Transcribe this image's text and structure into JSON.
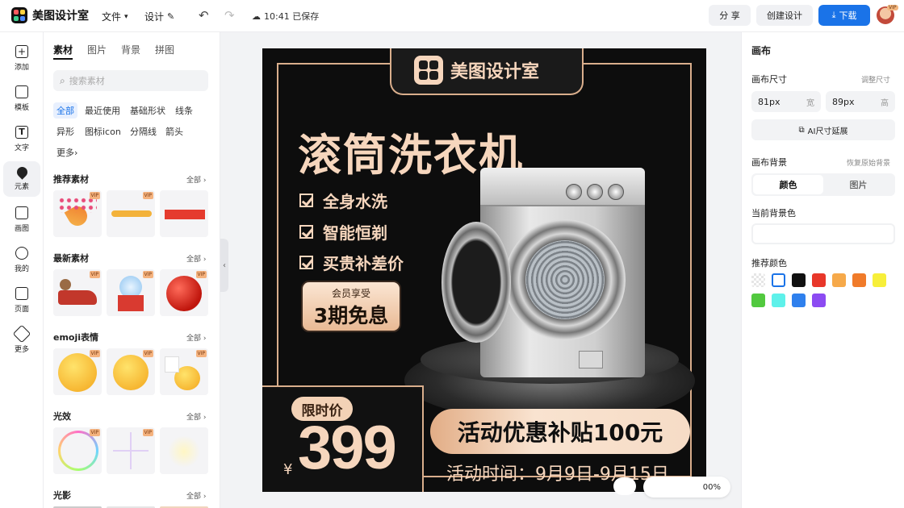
{
  "app": {
    "name": "美图设计室",
    "menu_file": "文件",
    "menu_design": "设计",
    "saved_status": "10:41 已保存",
    "btn_share": "分 享",
    "btn_create": "创建设计",
    "btn_download": "下载",
    "avatar_badge": "VIP"
  },
  "rail": [
    {
      "label": "添加",
      "icon": "plus-icon"
    },
    {
      "label": "模板",
      "icon": "template-icon"
    },
    {
      "label": "文字",
      "icon": "text-icon"
    },
    {
      "label": "元素",
      "icon": "element-icon",
      "active": true
    },
    {
      "label": "画图",
      "icon": "draw-icon"
    },
    {
      "label": "我的",
      "icon": "user-icon"
    },
    {
      "label": "页面",
      "icon": "page-icon"
    },
    {
      "label": "更多",
      "icon": "cube-icon"
    }
  ],
  "assets": {
    "tabs": [
      "素材",
      "图片",
      "背景",
      "拼图"
    ],
    "search_placeholder": "搜索素材",
    "chips": [
      "全部",
      "最近使用",
      "基础形状",
      "线条",
      "异形",
      "图标icon",
      "分隔线",
      "箭头",
      "更多"
    ],
    "sections": [
      {
        "title": "推荐素材",
        "all": "全部"
      },
      {
        "title": "最新素材",
        "all": "全部"
      },
      {
        "title": "emoji表情",
        "all": "全部"
      },
      {
        "title": "光效",
        "all": "全部"
      },
      {
        "title": "光影",
        "all": "全部"
      }
    ],
    "vip_label": "VIP"
  },
  "poster": {
    "brand": "美图设计室",
    "headline": "滚筒洗衣机",
    "features": [
      "全身水洗",
      "智能恒剃",
      "买贵补差价"
    ],
    "badge_top": "会员享受",
    "badge_main": "3期免息",
    "price_tag": "限时价",
    "currency": "¥",
    "price": "399",
    "promo": "活动优惠补贴100元",
    "date": "活动时间：9月9日-9月15日"
  },
  "zoom": "00%",
  "props": {
    "title": "画布",
    "size_label": "画布尺寸",
    "resize_link": "调整尺寸",
    "width_value": "81px",
    "width_unit": "宽",
    "height_value": "89px",
    "height_unit": "高",
    "ai_extend": "AI尺寸延展",
    "bg_label": "画布背景",
    "restore_link": "恢复原始背景",
    "seg_color": "颜色",
    "seg_image": "图片",
    "current_bg_label": "当前背景色",
    "recommended_label": "推荐颜色",
    "swatches": [
      "transparent",
      "#ffffff",
      "#111111",
      "#e8372a",
      "#f6a94a",
      "#f07b2a",
      "#f7ef3a",
      "#52c93f",
      "#5ef1ea",
      "#2f80ed",
      "#8c4bf2"
    ]
  }
}
